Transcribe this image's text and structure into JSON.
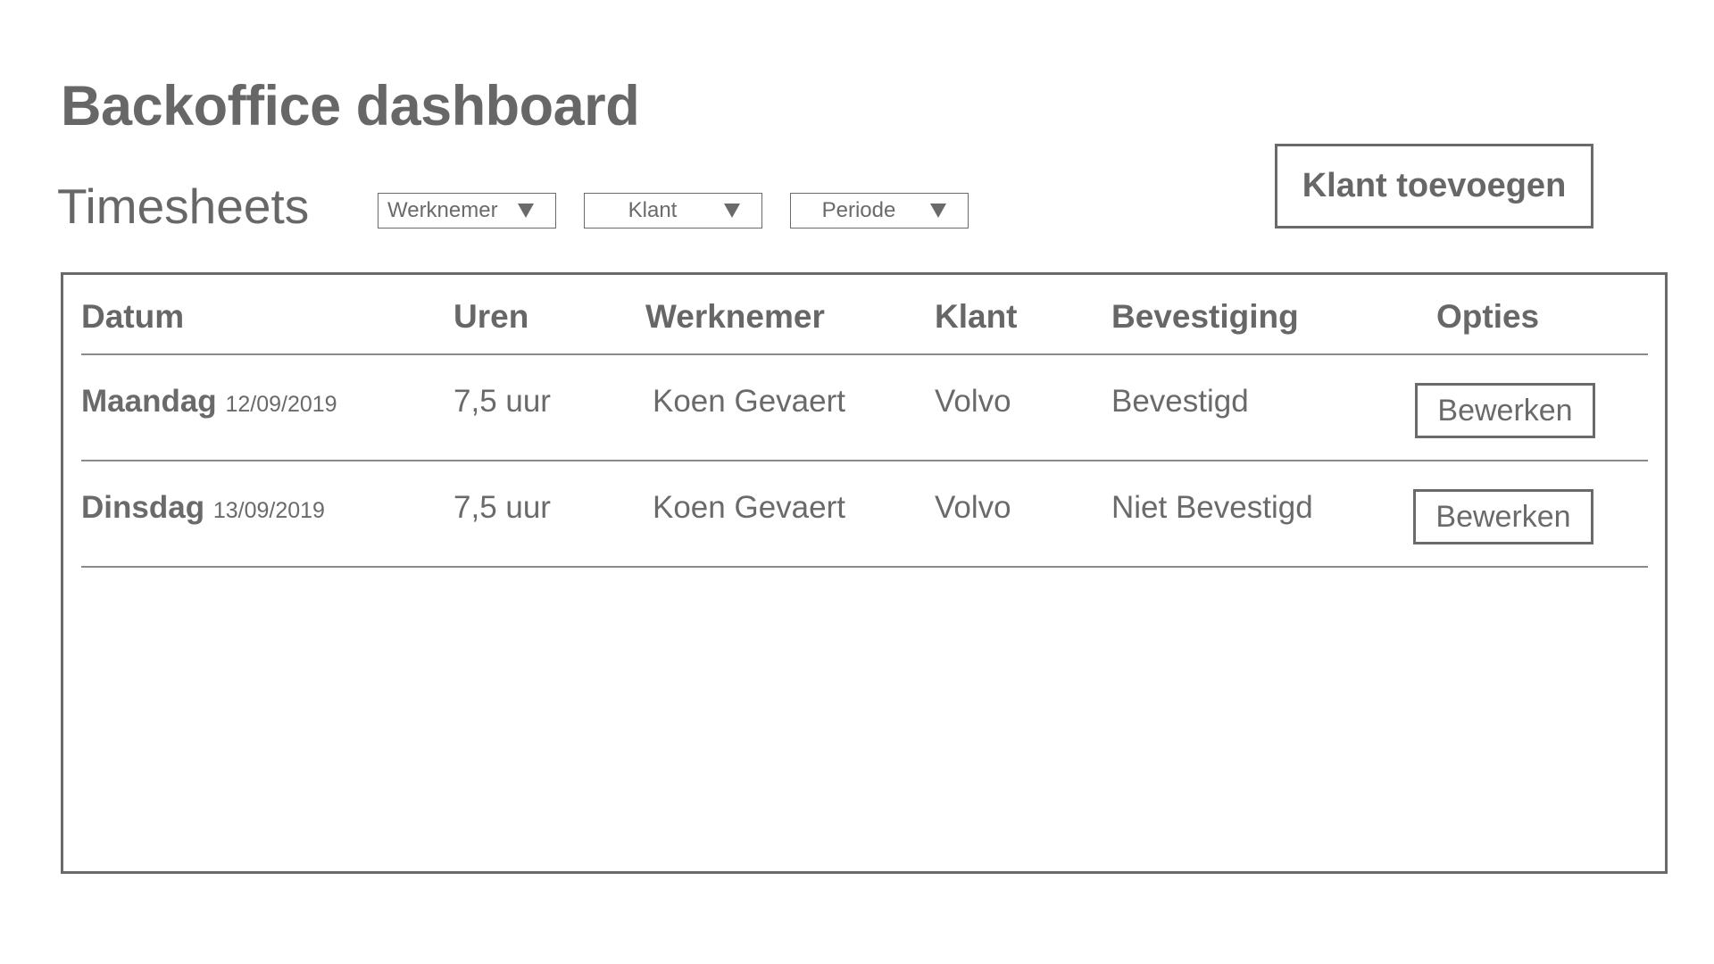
{
  "page": {
    "title": "Backoffice dashboard"
  },
  "section": {
    "title": "Timesheets"
  },
  "filters": [
    {
      "label": "Werknemer",
      "icon": "triangle-down-icon"
    },
    {
      "label": "Klant",
      "icon": "triangle-down-icon"
    },
    {
      "label": "Periode",
      "icon": "triangle-down-icon"
    }
  ],
  "actions": {
    "add_client_label": "Klant toevoegen"
  },
  "table": {
    "columns": [
      "Datum",
      "Uren",
      "Werknemer",
      "Klant",
      "Bevestiging",
      "Opties"
    ],
    "rows": [
      {
        "day": "Maandag",
        "date": "12/09/2019",
        "hours": "7,5 uur",
        "employee": "Koen Gevaert",
        "client": "Volvo",
        "status": "Bevestigd",
        "action": "Bewerken"
      },
      {
        "day": "Dinsdag",
        "date": "13/09/2019",
        "hours": "7,5 uur",
        "employee": "Koen Gevaert",
        "client": "Volvo",
        "status": "Niet Bevestigd",
        "action": "Bewerken"
      }
    ]
  },
  "colors": {
    "text": "#676767",
    "border": "#6a6a6a",
    "background": "#ffffff"
  }
}
